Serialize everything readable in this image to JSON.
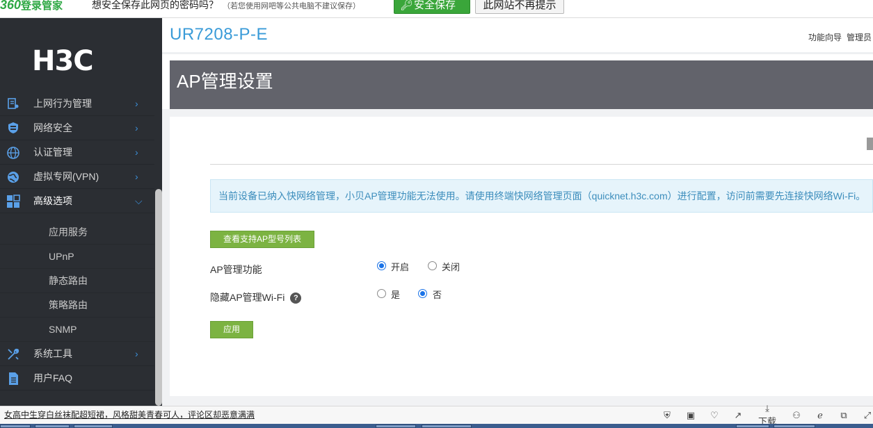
{
  "pwbar": {
    "logo_num": "360",
    "logo_text": "登录管家",
    "question": "想安全保存此网页的密码吗？",
    "hint": "（若您使用网吧等公共电脑不建议保存）",
    "save_label": "安全保存",
    "never_label": "此网站不再提示"
  },
  "brand": "H3C",
  "sidebar": {
    "items": [
      {
        "label": "上网行为管理",
        "icon": "behavior-icon"
      },
      {
        "label": "网络安全",
        "icon": "shield-icon"
      },
      {
        "label": "认证管理",
        "icon": "globe-icon"
      },
      {
        "label": "虚拟专网(VPN)",
        "icon": "vpn-globe-icon"
      },
      {
        "label": "高级选项",
        "icon": "grid-icon"
      },
      {
        "label": "系统工具",
        "icon": "tools-icon"
      },
      {
        "label": "用户FAQ",
        "icon": "document-icon"
      }
    ],
    "subitems": [
      "应用服务",
      "UPnP",
      "静态路由",
      "策略路由",
      "SNMP"
    ]
  },
  "device_name": "UR7208-P-E",
  "topnav": [
    "功能向导",
    "管理员"
  ],
  "page_title": "AP管理设置",
  "notice": "当前设备已纳入快网络管理，小贝AP管理功能无法使用。请使用终端快网络管理页面（quicknet.h3c.com）进行配置，访问前需要先连接快网络Wi-Fi。",
  "form": {
    "list_button": "查看支持AP型号列表",
    "ap_manage_label": "AP管理功能",
    "ap_manage_on": "开启",
    "ap_manage_off": "关闭",
    "ap_manage_value": "开启",
    "hide_wifi_label": "隐藏AP管理Wi-Fi",
    "hide_yes": "是",
    "hide_no": "否",
    "hide_value": "否",
    "apply_button": "应用"
  },
  "bottombar": {
    "news": "女高中生穿白丝袜配超短裙，风格甜美青春可人，评论区却恶意满满",
    "download": "下载"
  },
  "colors": {
    "accent_blue": "#3a9bd8",
    "green_button": "#7cb342",
    "sidebar_bg": "#2b2e33",
    "header_bg": "#62636b"
  }
}
